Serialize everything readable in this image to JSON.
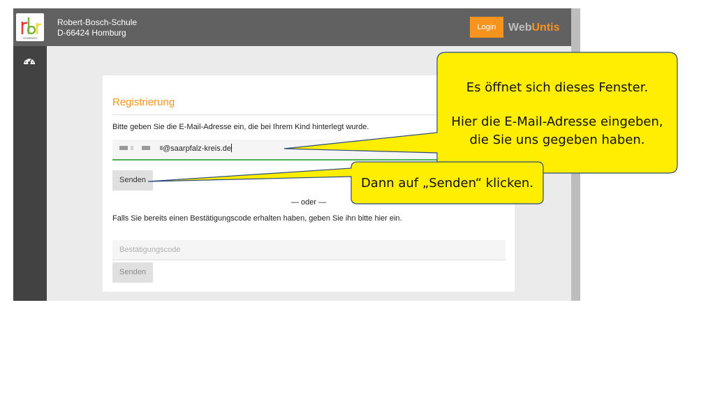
{
  "header": {
    "school_name": "Robert-Bosch-Schule",
    "school_address": "D-66424 Homburg",
    "logo_text": "HOMBURG",
    "login_label": "Login",
    "brand_web": "Web",
    "brand_untis": "Untis"
  },
  "sidebar": {
    "icon": "dashboard-icon"
  },
  "registration": {
    "title": "Registrierung",
    "email_prompt": "Bitte geben Sie die E-Mail-Adresse ein, die bei Ihrem Kind hinterlegt wurde.",
    "email_value": "@saarpfalz-kreis.de",
    "send_label": "Senden",
    "or_label": "— oder —",
    "code_prompt": "Falls Sie bereits einen Bestätigungscode erhalten haben, geben Sie ihn bitte hier ein.",
    "code_placeholder": "Bestätigungscode",
    "send2_label": "Senden"
  },
  "callouts": {
    "top_line1": "Es öffnet sich dieses Fenster.",
    "top_line2": "Hier die E-Mail-Adresse eingeben,",
    "top_line3": "die Sie uns gegeben haben.",
    "bottom": "Dann auf „Senden“ klicken."
  },
  "colors": {
    "accent": "#f7941d",
    "callout_fill": "#ffee00",
    "callout_border": "#2f4b7c",
    "input_focus": "#4caf50"
  }
}
